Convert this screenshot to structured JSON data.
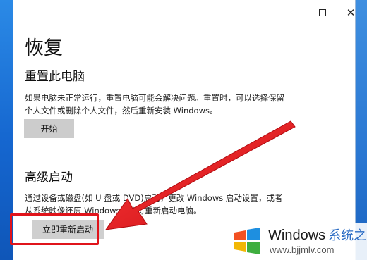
{
  "window": {
    "minimize_icon": "minimize-icon",
    "maximize_icon": "maximize-icon",
    "close_icon": "close-icon",
    "close_glyph": "✕"
  },
  "page": {
    "title": "恢复"
  },
  "reset_section": {
    "title": "重置此电脑",
    "description": "如果电脑未正常运行，重置电脑可能会解决问题。重置时，可以选择保留个人文件或删除个人文件，然后重新安装 Windows。",
    "button_label": "开始"
  },
  "advanced_startup": {
    "title": "高级启动",
    "description": "通过设备或磁盘(如 U 盘或 DVD)启动，更改 Windows 启动设置，或者从系统映像还原 Windows。这将重新启动电脑。",
    "button_label": "立即重新启动"
  },
  "annotation": {
    "highlight_color": "#e0141b",
    "arrow_color": "#e0141b"
  },
  "watermark": {
    "brand": "Windows",
    "brand_cn": "系统之家",
    "url": "www.bjjmlv.com"
  },
  "colors": {
    "desktop_blue": "#1b6fd6",
    "button_gray": "#cccccc"
  }
}
